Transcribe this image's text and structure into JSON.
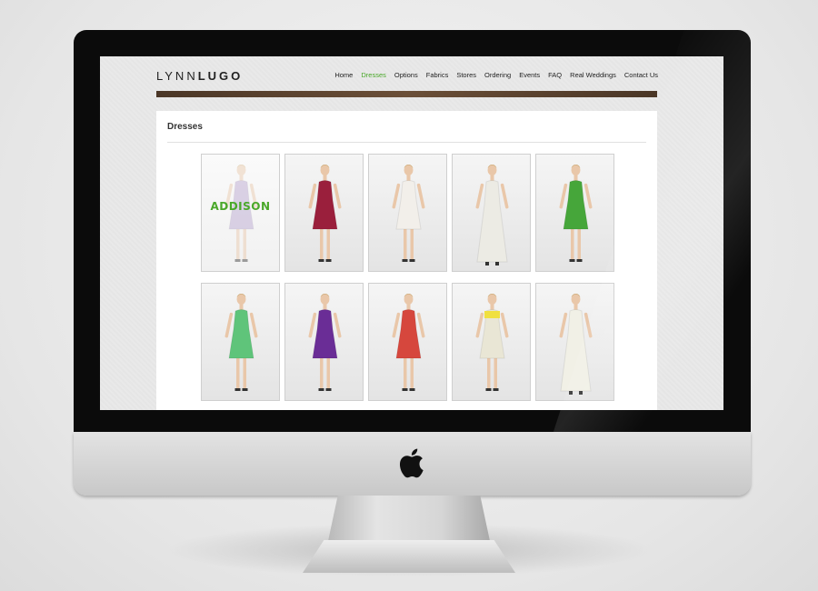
{
  "site": {
    "logo_light": "LYNN",
    "logo_bold": "LUGO",
    "nav": [
      {
        "label": "Home",
        "active": false
      },
      {
        "label": "Dresses",
        "active": true
      },
      {
        "label": "Options",
        "active": false
      },
      {
        "label": "Fabrics",
        "active": false
      },
      {
        "label": "Stores",
        "active": false
      },
      {
        "label": "Ordering",
        "active": false
      },
      {
        "label": "Events",
        "active": false
      },
      {
        "label": "FAQ",
        "active": false
      },
      {
        "label": "Real Weddings",
        "active": false
      },
      {
        "label": "Contact Us",
        "active": false
      }
    ],
    "page_title": "Dresses"
  },
  "dresses": [
    {
      "color": "#b6a3cf",
      "style": "short",
      "hover_label": "ADDISON"
    },
    {
      "color": "#9a1f3c",
      "style": "short"
    },
    {
      "color": "#f2efea",
      "style": "short"
    },
    {
      "color": "#ecebe4",
      "style": "gown"
    },
    {
      "color": "#46a63a",
      "style": "short"
    },
    {
      "color": "#5fc47a",
      "style": "short"
    },
    {
      "color": "#6a2d96",
      "style": "short"
    },
    {
      "color": "#d6473d",
      "style": "short"
    },
    {
      "color": "#e9e6d5",
      "style": "short",
      "accent": "#f0e040"
    },
    {
      "color": "#f1f0e6",
      "style": "gown"
    }
  ],
  "icons": {
    "apple": "apple-logo-icon"
  }
}
